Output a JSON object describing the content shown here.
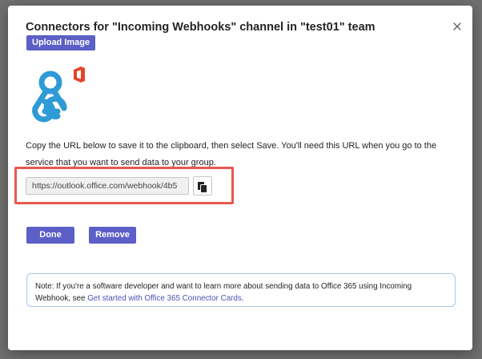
{
  "dialog": {
    "title": "Connectors for \"Incoming Webhooks\" channel in \"test01\" team",
    "close_icon": "close-icon",
    "upload_label": "Upload Image",
    "logo_icon": "webhook-logo-icon",
    "instruction": "Copy the URL below to save it to the clipboard, then select Save. You'll need this URL when you go to the service that you want to send data to your group.",
    "url_value": "https://outlook.office.com/webhook/4b5",
    "copy_icon": "copy-icon",
    "done_label": "Done",
    "remove_label": "Remove",
    "note_text": "Note: If you're a software developer and want to learn more about sending data to Office 365 using Incoming Webhook, see ",
    "note_link": "Get started with Office 365 Connector Cards",
    "note_end": "."
  },
  "colors": {
    "accent": "#5b5fc7",
    "highlight": "#e8584f",
    "logo_blue": "#2e9ad6",
    "office_red": "#e3442a",
    "link": "#4f52b2"
  }
}
